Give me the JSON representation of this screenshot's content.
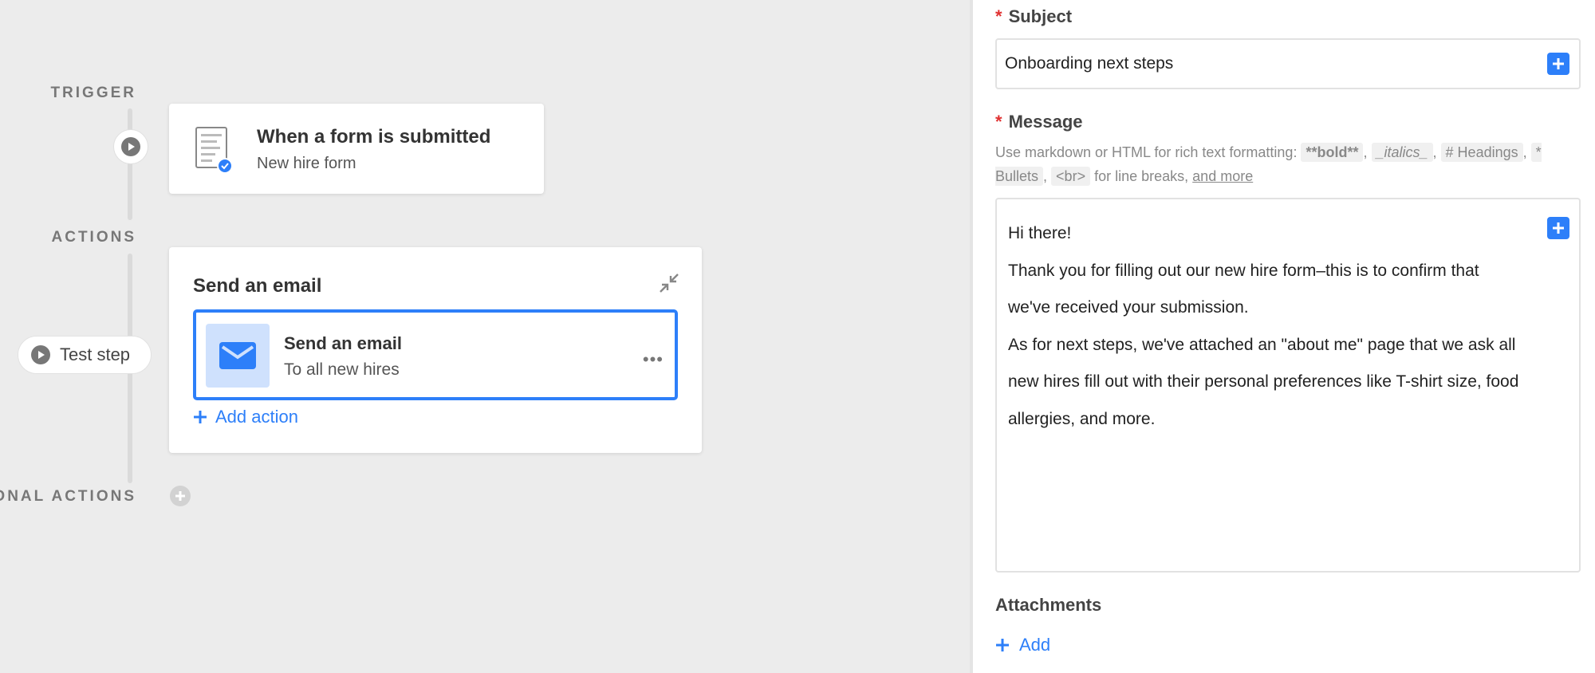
{
  "canvas": {
    "trigger_label": "TRIGGER",
    "actions_label": "ACTIONS",
    "conditional_label": "IONAL ACTIONS",
    "trigger_card": {
      "title": "When a form is submitted",
      "subtitle": "New hire form"
    },
    "test_step_label": "Test step",
    "action_card": {
      "title": "Send an email",
      "step_title": "Send an email",
      "step_subtitle": "To all new hires",
      "more_label": "•••",
      "add_action_label": "Add action"
    }
  },
  "panel": {
    "subject": {
      "required_mark": "*",
      "label": "Subject",
      "value": "Onboarding next steps"
    },
    "message": {
      "required_mark": "*",
      "label": "Message",
      "hint_prefix": "Use markdown or HTML for rich text formatting:",
      "hint_codes": [
        "**bold**",
        "_italics_",
        "# Headings",
        "* Bullets",
        "<br>"
      ],
      "hint_linebreaks": "for line breaks,",
      "hint_link": "and more",
      "lines": [
        "Hi there!",
        "Thank you for filling out our new hire form–this is to confirm that",
        "we've received your submission.",
        "As for next steps, we've attached an \"about me\" page that we ask all",
        "new hires fill out with their personal preferences like T-shirt size, food",
        "allergies, and more."
      ]
    },
    "attachments": {
      "label": "Attachments",
      "add_label": "Add"
    }
  },
  "colors": {
    "accent": "#2d7ff9",
    "required": "#e03131",
    "canvas_bg": "#ececec"
  },
  "icons": [
    "form-icon",
    "play-icon",
    "envelope-icon",
    "compress-icon",
    "plus-icon",
    "more-icon"
  ]
}
